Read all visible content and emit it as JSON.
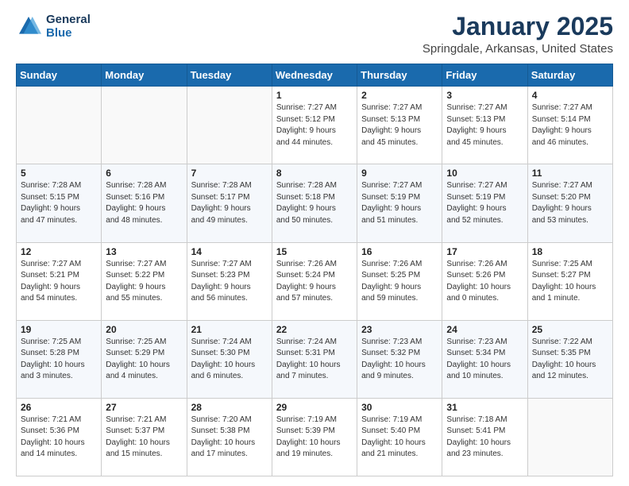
{
  "logo": {
    "line1": "General",
    "line2": "Blue"
  },
  "title": "January 2025",
  "subtitle": "Springdale, Arkansas, United States",
  "days_of_week": [
    "Sunday",
    "Monday",
    "Tuesday",
    "Wednesday",
    "Thursday",
    "Friday",
    "Saturday"
  ],
  "weeks": [
    [
      {
        "day": "",
        "info": ""
      },
      {
        "day": "",
        "info": ""
      },
      {
        "day": "",
        "info": ""
      },
      {
        "day": "1",
        "info": "Sunrise: 7:27 AM\nSunset: 5:12 PM\nDaylight: 9 hours\nand 44 minutes."
      },
      {
        "day": "2",
        "info": "Sunrise: 7:27 AM\nSunset: 5:13 PM\nDaylight: 9 hours\nand 45 minutes."
      },
      {
        "day": "3",
        "info": "Sunrise: 7:27 AM\nSunset: 5:13 PM\nDaylight: 9 hours\nand 45 minutes."
      },
      {
        "day": "4",
        "info": "Sunrise: 7:27 AM\nSunset: 5:14 PM\nDaylight: 9 hours\nand 46 minutes."
      }
    ],
    [
      {
        "day": "5",
        "info": "Sunrise: 7:28 AM\nSunset: 5:15 PM\nDaylight: 9 hours\nand 47 minutes."
      },
      {
        "day": "6",
        "info": "Sunrise: 7:28 AM\nSunset: 5:16 PM\nDaylight: 9 hours\nand 48 minutes."
      },
      {
        "day": "7",
        "info": "Sunrise: 7:28 AM\nSunset: 5:17 PM\nDaylight: 9 hours\nand 49 minutes."
      },
      {
        "day": "8",
        "info": "Sunrise: 7:28 AM\nSunset: 5:18 PM\nDaylight: 9 hours\nand 50 minutes."
      },
      {
        "day": "9",
        "info": "Sunrise: 7:27 AM\nSunset: 5:19 PM\nDaylight: 9 hours\nand 51 minutes."
      },
      {
        "day": "10",
        "info": "Sunrise: 7:27 AM\nSunset: 5:19 PM\nDaylight: 9 hours\nand 52 minutes."
      },
      {
        "day": "11",
        "info": "Sunrise: 7:27 AM\nSunset: 5:20 PM\nDaylight: 9 hours\nand 53 minutes."
      }
    ],
    [
      {
        "day": "12",
        "info": "Sunrise: 7:27 AM\nSunset: 5:21 PM\nDaylight: 9 hours\nand 54 minutes."
      },
      {
        "day": "13",
        "info": "Sunrise: 7:27 AM\nSunset: 5:22 PM\nDaylight: 9 hours\nand 55 minutes."
      },
      {
        "day": "14",
        "info": "Sunrise: 7:27 AM\nSunset: 5:23 PM\nDaylight: 9 hours\nand 56 minutes."
      },
      {
        "day": "15",
        "info": "Sunrise: 7:26 AM\nSunset: 5:24 PM\nDaylight: 9 hours\nand 57 minutes."
      },
      {
        "day": "16",
        "info": "Sunrise: 7:26 AM\nSunset: 5:25 PM\nDaylight: 9 hours\nand 59 minutes."
      },
      {
        "day": "17",
        "info": "Sunrise: 7:26 AM\nSunset: 5:26 PM\nDaylight: 10 hours\nand 0 minutes."
      },
      {
        "day": "18",
        "info": "Sunrise: 7:25 AM\nSunset: 5:27 PM\nDaylight: 10 hours\nand 1 minute."
      }
    ],
    [
      {
        "day": "19",
        "info": "Sunrise: 7:25 AM\nSunset: 5:28 PM\nDaylight: 10 hours\nand 3 minutes."
      },
      {
        "day": "20",
        "info": "Sunrise: 7:25 AM\nSunset: 5:29 PM\nDaylight: 10 hours\nand 4 minutes."
      },
      {
        "day": "21",
        "info": "Sunrise: 7:24 AM\nSunset: 5:30 PM\nDaylight: 10 hours\nand 6 minutes."
      },
      {
        "day": "22",
        "info": "Sunrise: 7:24 AM\nSunset: 5:31 PM\nDaylight: 10 hours\nand 7 minutes."
      },
      {
        "day": "23",
        "info": "Sunrise: 7:23 AM\nSunset: 5:32 PM\nDaylight: 10 hours\nand 9 minutes."
      },
      {
        "day": "24",
        "info": "Sunrise: 7:23 AM\nSunset: 5:34 PM\nDaylight: 10 hours\nand 10 minutes."
      },
      {
        "day": "25",
        "info": "Sunrise: 7:22 AM\nSunset: 5:35 PM\nDaylight: 10 hours\nand 12 minutes."
      }
    ],
    [
      {
        "day": "26",
        "info": "Sunrise: 7:21 AM\nSunset: 5:36 PM\nDaylight: 10 hours\nand 14 minutes."
      },
      {
        "day": "27",
        "info": "Sunrise: 7:21 AM\nSunset: 5:37 PM\nDaylight: 10 hours\nand 15 minutes."
      },
      {
        "day": "28",
        "info": "Sunrise: 7:20 AM\nSunset: 5:38 PM\nDaylight: 10 hours\nand 17 minutes."
      },
      {
        "day": "29",
        "info": "Sunrise: 7:19 AM\nSunset: 5:39 PM\nDaylight: 10 hours\nand 19 minutes."
      },
      {
        "day": "30",
        "info": "Sunrise: 7:19 AM\nSunset: 5:40 PM\nDaylight: 10 hours\nand 21 minutes."
      },
      {
        "day": "31",
        "info": "Sunrise: 7:18 AM\nSunset: 5:41 PM\nDaylight: 10 hours\nand 23 minutes."
      },
      {
        "day": "",
        "info": ""
      }
    ]
  ]
}
